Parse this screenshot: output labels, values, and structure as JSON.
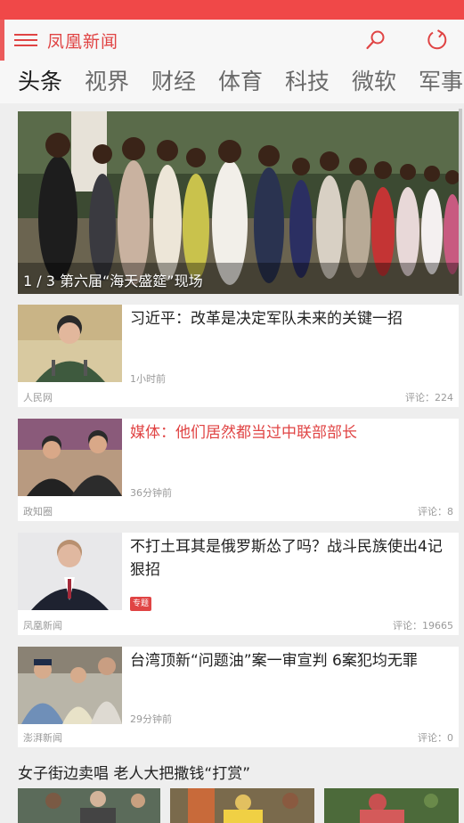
{
  "app": {
    "title": "凤凰新闻"
  },
  "icons": {
    "menu": "menu-icon",
    "search": "search-icon",
    "refresh": "refresh-icon"
  },
  "colors": {
    "brand": "#e04444",
    "statusbar": "#f04848"
  },
  "tabs": [
    {
      "label": "头条",
      "active": true
    },
    {
      "label": "视界",
      "active": false
    },
    {
      "label": "财经",
      "active": false
    },
    {
      "label": "体育",
      "active": false
    },
    {
      "label": "科技",
      "active": false
    },
    {
      "label": "微软",
      "active": false
    },
    {
      "label": "军事",
      "active": false
    }
  ],
  "hero": {
    "caption": "1 / 3 第六届“海天盛筵”现场"
  },
  "articles": [
    {
      "title": "习近平：改革是决定军队未来的关键一招",
      "time": "1小时前",
      "source": "人民网",
      "comments": "评论：224",
      "highlighted": false
    },
    {
      "title": "媒体：他们居然都当过中联部部长",
      "time": "36分钟前",
      "source": "政知圈",
      "comments": "评论：8",
      "highlighted": true
    },
    {
      "title": "不打土耳其是俄罗斯怂了吗？战斗民族使出4记狠招",
      "tag": "专题",
      "source": "凤凰新闻",
      "comments": "评论：19665",
      "highlighted": false
    },
    {
      "title": "台湾顶新“问题油”案一审宣判 6案犯均无罪",
      "time": "29分钟前",
      "source": "澎湃新闻",
      "comments": "评论：0",
      "highlighted": false
    }
  ],
  "gallery": {
    "title": "女子街边卖唱 老人大把撒钱“打赏”"
  }
}
